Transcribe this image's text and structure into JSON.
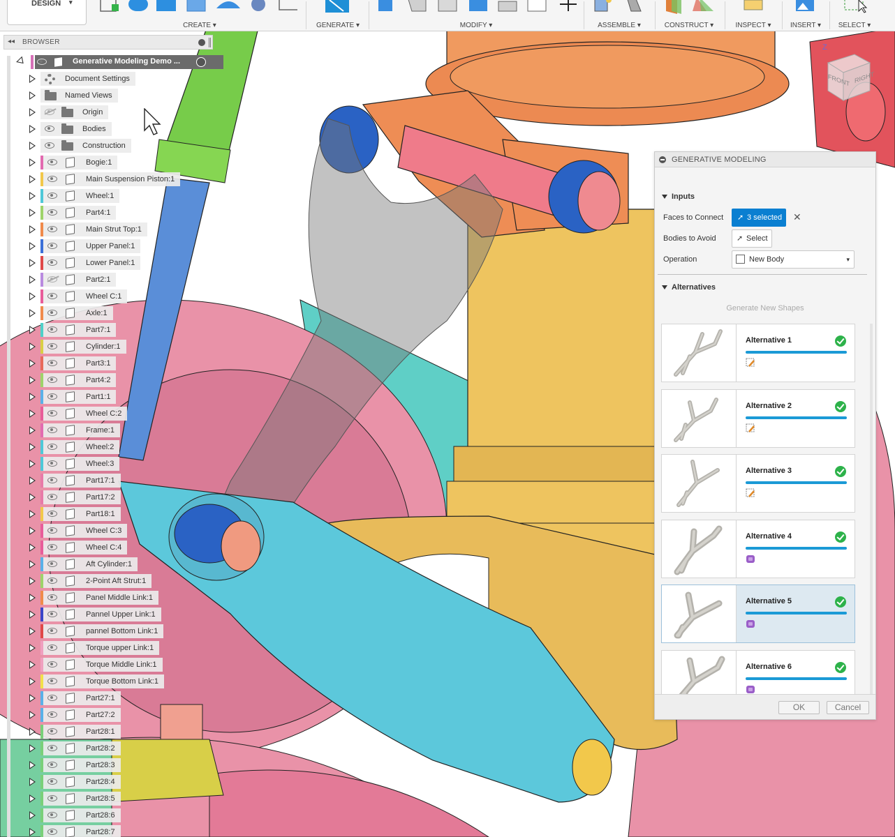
{
  "toolbar": {
    "workspace": "DESIGN",
    "groups": [
      "CREATE",
      "GENERATE",
      "MODIFY",
      "ASSEMBLE",
      "CONSTRUCT",
      "INSPECT",
      "INSERT",
      "SELECT"
    ]
  },
  "browser": {
    "title": "BROWSER",
    "root": "Generative Modeling Demo ...",
    "items": [
      {
        "label": "Document Settings",
        "kind": "settings",
        "color": ""
      },
      {
        "label": "Named Views",
        "kind": "folder",
        "color": ""
      },
      {
        "label": "Origin",
        "kind": "folder",
        "color": "",
        "hidden": true
      },
      {
        "label": "Bodies",
        "kind": "folder",
        "color": ""
      },
      {
        "label": "Construction",
        "kind": "folder",
        "color": ""
      },
      {
        "label": "Bogie:1",
        "color": "#e26bb0"
      },
      {
        "label": "Main Suspension Piston:1",
        "color": "#f2c84b"
      },
      {
        "label": "Wheel:1",
        "color": "#4fc8d8"
      },
      {
        "label": "Part4:1",
        "color": "#9ed36a"
      },
      {
        "label": "Main Strut Top:1",
        "color": "#f08a4b"
      },
      {
        "label": "Upper Panel:1",
        "color": "#3b6fd8"
      },
      {
        "label": "Lower Panel:1",
        "color": "#e04848"
      },
      {
        "label": "Part2:1",
        "color": "#b98be0",
        "hidden": true
      },
      {
        "label": "Wheel C:1",
        "color": "#e85d9a"
      },
      {
        "label": "Axle:1",
        "color": "#f08a4b"
      },
      {
        "label": "Part7:1",
        "color": "#4fd0c8"
      },
      {
        "label": "Cylinder:1",
        "color": "#d9cf45"
      },
      {
        "label": "Part3:1",
        "color": "#e86a5a"
      },
      {
        "label": "Part4:2",
        "color": "#9ed36a"
      },
      {
        "label": "Part1:1",
        "color": "#5ab0e8"
      },
      {
        "label": "Wheel C:2",
        "color": "#e85d9a"
      },
      {
        "label": "Frame:1",
        "color": "#e26bb0"
      },
      {
        "label": "Wheel:2",
        "color": "#4fc8d8"
      },
      {
        "label": "Wheel:3",
        "color": "#4fc8d8"
      },
      {
        "label": "Part17:1",
        "color": "#e87aa8"
      },
      {
        "label": "Part17:2",
        "color": "#e87aa8"
      },
      {
        "label": "Part18:1",
        "color": "#f2c84b"
      },
      {
        "label": "Wheel C:3",
        "color": "#e85d9a"
      },
      {
        "label": "Wheel C:4",
        "color": "#e85d9a"
      },
      {
        "label": "Aft Cylinder:1",
        "color": "#5ab0e8"
      },
      {
        "label": "2-Point Aft Strut:1",
        "color": "#9ed36a"
      },
      {
        "label": "Panel Middle Link:1",
        "color": "#f08a4b"
      },
      {
        "label": "Pannel Upper Link:1",
        "color": "#3b45c8"
      },
      {
        "label": "pannel Bottom Link:1",
        "color": "#e04848"
      },
      {
        "label": "Torque upper Link:1",
        "color": "#f0a0c0"
      },
      {
        "label": "Torque Middle Link:1",
        "color": "#f0a0c0"
      },
      {
        "label": "Torque Bottom Link:1",
        "color": "#f2e04b"
      },
      {
        "label": "Part27:1",
        "color": "#5ab0e8"
      },
      {
        "label": "Part27:2",
        "color": "#5ab0e8"
      },
      {
        "label": "Part28:1",
        "color": "#7ad07a"
      },
      {
        "label": "Part28:2",
        "color": "#7ad07a"
      },
      {
        "label": "Part28:3",
        "color": "#7ad07a"
      },
      {
        "label": "Part28:4",
        "color": "#7ad07a"
      },
      {
        "label": "Part28:5",
        "color": "#7ad07a"
      },
      {
        "label": "Part28:6",
        "color": "#7ad07a"
      },
      {
        "label": "Part28:7",
        "color": "#7ad07a"
      }
    ]
  },
  "panel": {
    "title": "GENERATIVE MODELING",
    "inputs_heading": "Inputs",
    "faces_label": "Faces to Connect",
    "faces_value": "3 selected",
    "bodies_label": "Bodies to Avoid",
    "bodies_value": "Select",
    "operation_label": "Operation",
    "operation_value": "New Body",
    "alternatives_heading": "Alternatives",
    "generate_new": "Generate New Shapes",
    "alternatives": [
      {
        "name": "Alternative 1",
        "type": "sketch",
        "selected": false
      },
      {
        "name": "Alternative 2",
        "type": "sketch",
        "selected": false
      },
      {
        "name": "Alternative 3",
        "type": "sketch",
        "selected": false
      },
      {
        "name": "Alternative 4",
        "type": "mesh",
        "selected": false
      },
      {
        "name": "Alternative 5",
        "type": "mesh",
        "selected": true
      },
      {
        "name": "Alternative 6",
        "type": "mesh",
        "selected": false
      }
    ],
    "ok": "OK",
    "cancel": "Cancel"
  },
  "viewcube": {
    "front": "FRONT",
    "right": "RIGHT",
    "axis": "Z"
  }
}
